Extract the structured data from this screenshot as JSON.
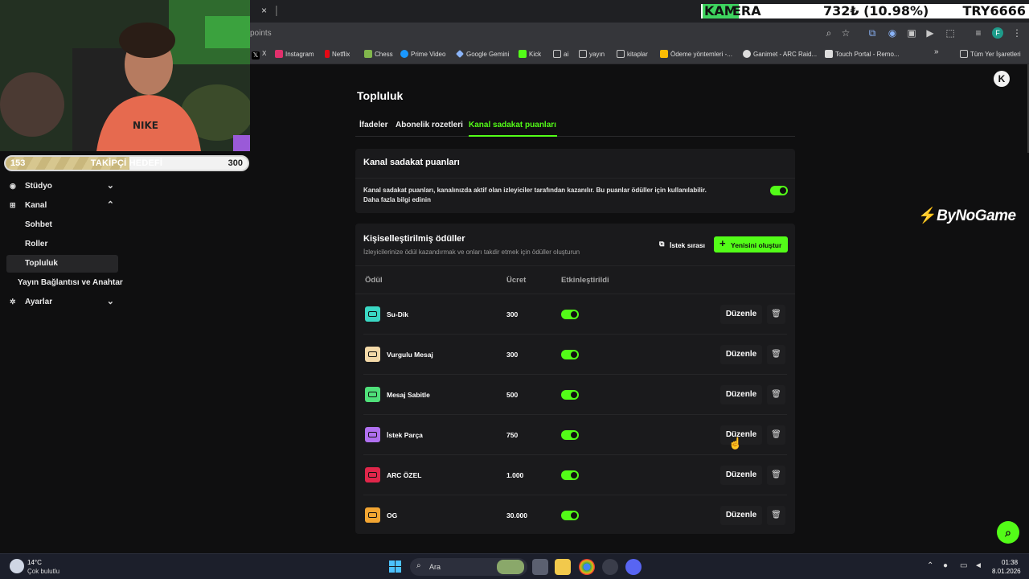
{
  "browser": {
    "tab_close": "×",
    "url": "points",
    "bookmarks": [
      {
        "label": "X",
        "color": "#000000"
      },
      {
        "label": "Instagram",
        "color": "#e1306c"
      },
      {
        "label": "Netflix",
        "color": "#e50914"
      },
      {
        "label": "Chess",
        "color": "#81b64c"
      },
      {
        "label": "Prime Video",
        "color": "#1a98ff"
      },
      {
        "label": "Google Gemini",
        "color": "#8ab4f8"
      },
      {
        "label": "Kick",
        "color": "#53fc18"
      },
      {
        "label": "ai",
        "color": "#c8c8c8"
      },
      {
        "label": "yayın",
        "color": "#c8c8c8"
      },
      {
        "label": "kitaplar",
        "color": "#c8c8c8"
      },
      {
        "label": "Ödeme yöntemleri -...",
        "color": "#fbbc04"
      },
      {
        "label": "Ganimet - ARC Raid...",
        "color": "#dddddd"
      },
      {
        "label": "Touch Portal - Remo...",
        "color": "#dddddd"
      },
      {
        "label": "Tüm Yer İşaretleri",
        "color": "#c8c8c8"
      }
    ],
    "more": "»"
  },
  "ticker": {
    "kam": "KAM",
    "era": "ERA",
    "price": "732₺ (10.98%)",
    "symbol": "TRY6666"
  },
  "goal": {
    "start": "153",
    "title": "TAKİPÇİ HEDEFİ",
    "end": "300",
    "progress": 0.51
  },
  "sidebar": {
    "studio": "Stüdyo",
    "channel": "Kanal",
    "chat": "Sohbet",
    "roles": "Roller",
    "community": "Topluluk",
    "stream_key": "Yayın Bağlantısı ve Anahtar",
    "settings": "Ayarlar"
  },
  "main": {
    "title": "Topluluk",
    "tabs": [
      "İfadeler",
      "Abonelik rozetleri",
      "Kanal sadakat puanları"
    ],
    "loyalty_card": {
      "title": "Kanal sadakat puanları",
      "description_1": "Kanal sadakat puanları, kanalınızda aktif olan izleyiciler tarafından kazanılır. Bu puanlar ödüller için kullanılabilir.",
      "description_2": "Daha fazla bilgi edinin"
    },
    "rewards_card": {
      "title": "Kişiselleştirilmiş ödüller",
      "subtitle": "İzleyicilerinize ödül kazandırmak ve onları takdir etmek için ödüller oluşturun",
      "queue_label": "İstek sırası",
      "create_label": "Yenisini oluştur",
      "columns": [
        "Ödül",
        "Ücret",
        "Etkinleştirildi"
      ],
      "edit_label": "Düzenle",
      "rows": [
        {
          "name": "Su-Dik",
          "cost": "300",
          "color": "#3ad8c4"
        },
        {
          "name": "Vurgulu Mesaj",
          "cost": "300",
          "color": "#f3d9a8"
        },
        {
          "name": "Mesaj Sabitle",
          "cost": "500",
          "color": "#4fe07a"
        },
        {
          "name": "İstek Parça",
          "cost": "750",
          "color": "#b070f0"
        },
        {
          "name": "ARC ÖZEL",
          "cost": "1.000",
          "color": "#e0264a"
        },
        {
          "name": "OG",
          "cost": "30.000",
          "color": "#f2a532"
        }
      ]
    }
  },
  "overlay": {
    "brand": "ByNoGame"
  },
  "taskbar": {
    "temp": "14°C",
    "weather": "Çok bulutlu",
    "search": "Ara",
    "time": "01:38",
    "date": "8.01.2026"
  }
}
